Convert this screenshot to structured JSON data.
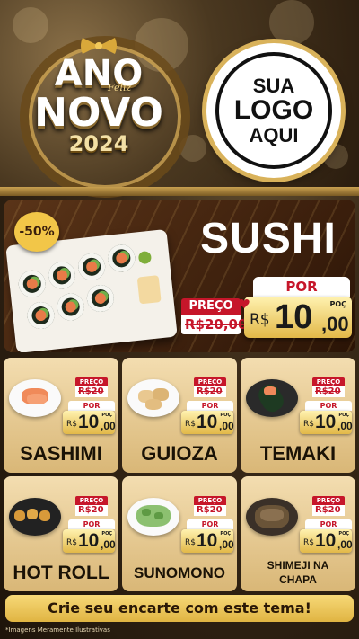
{
  "header": {
    "headline_top": "ANO",
    "headline_script": "Feliz",
    "headline_bottom": "NOVO",
    "year": "2024",
    "logo_placeholder": [
      "SUA",
      "LOGO",
      "AQUI"
    ]
  },
  "hero": {
    "discount_badge": "-50%",
    "title": "SUSHI",
    "preco_label": "PREÇO",
    "old_price": "R$20,00",
    "por_label": "POR",
    "currency": "R$",
    "price_int": "10",
    "price_dec": ",00",
    "poc_label": "POÇ"
  },
  "products": [
    {
      "name": "SASHIMI",
      "preco_label": "PREÇO",
      "old_price": "R$20",
      "por_label": "POR",
      "currency": "R$",
      "price_int": "10",
      "price_dec": ",00",
      "poc_label": "POÇ"
    },
    {
      "name": "GUIOZA",
      "preco_label": "PREÇO",
      "old_price": "R$20",
      "por_label": "POR",
      "currency": "R$",
      "price_int": "10",
      "price_dec": ",00",
      "poc_label": "POÇ"
    },
    {
      "name": "TEMAKI",
      "preco_label": "PREÇO",
      "old_price": "R$20",
      "por_label": "POR",
      "currency": "R$",
      "price_int": "10",
      "price_dec": ",00",
      "poc_label": "POÇ"
    },
    {
      "name": "HOT ROLL",
      "preco_label": "PREÇO",
      "old_price": "R$20",
      "por_label": "POR",
      "currency": "R$",
      "price_int": "10",
      "price_dec": ",00",
      "poc_label": "POÇ"
    },
    {
      "name": "SUNOMONO",
      "preco_label": "PREÇO",
      "old_price": "R$20",
      "por_label": "POR",
      "currency": "R$",
      "price_int": "10",
      "price_dec": ",00",
      "poc_label": "POÇ"
    },
    {
      "name": "SHIMEJI NA CHAPA",
      "preco_label": "PREÇO",
      "old_price": "R$20",
      "por_label": "POR",
      "currency": "R$",
      "price_int": "10",
      "price_dec": ",00",
      "poc_label": "POÇ"
    }
  ],
  "footer": {
    "cta": "Crie seu encarte com este tema!",
    "disclaimer": "*Imagens Meramente Ilustrativas"
  },
  "colors": {
    "accent_red": "#c6162a",
    "gold": "#e2b848",
    "card_bg": "#f3ddb0",
    "hero_bg": "#5a3418"
  }
}
